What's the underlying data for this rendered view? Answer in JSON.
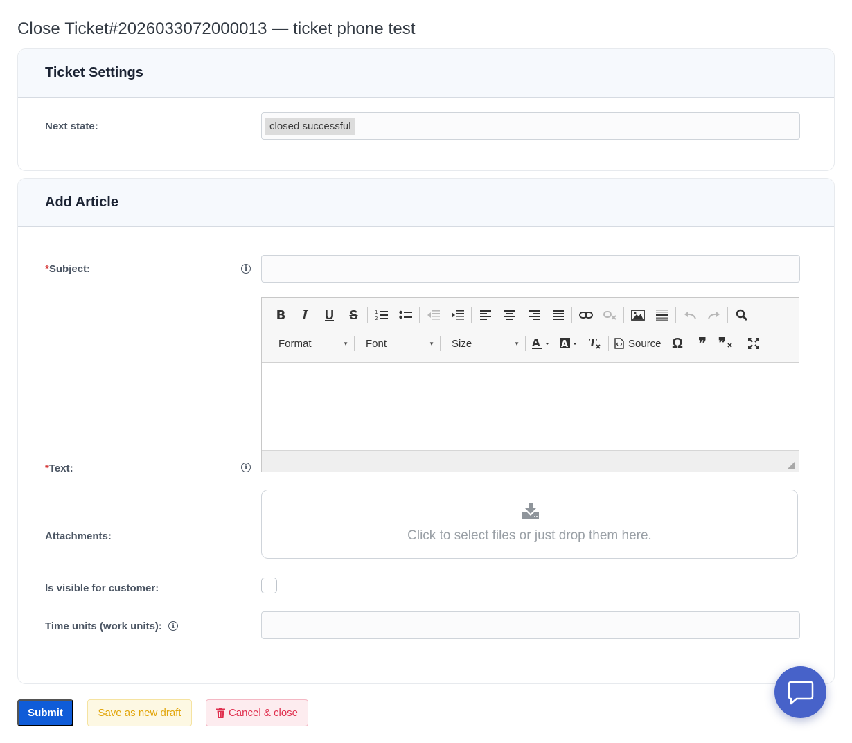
{
  "page": {
    "title": "Close Ticket#2026033072000013 — ticket phone test"
  },
  "ticket_settings": {
    "heading": "Ticket Settings",
    "next_state_label": "Next state:",
    "next_state_value": "closed successful"
  },
  "add_article": {
    "heading": "Add Article",
    "subject_required_mark": "*",
    "subject_label": "Subject:",
    "subject_value": "",
    "text_required_mark": "*",
    "text_label": "Text:",
    "text_value": "",
    "attachments_label": "Attachments:",
    "attachments_hint": "Click to select files or just drop them here.",
    "visible_label": "Is visible for customer:",
    "visible_checked": false,
    "time_units_label": "Time units (work units):",
    "time_units_value": ""
  },
  "editor": {
    "toolbar_row1": [
      "bold-icon",
      "italic-icon",
      "underline-icon",
      "strikethrough-icon",
      "numbered-list-icon",
      "bulleted-list-icon",
      "outdent-icon",
      "indent-icon",
      "align-left-icon",
      "align-center-icon",
      "align-right-icon",
      "justify-icon",
      "link-icon",
      "unlink-icon",
      "image-icon",
      "horizontal-line-icon",
      "undo-icon",
      "redo-icon",
      "find-icon"
    ],
    "format_label": "Format",
    "font_label": "Font",
    "size_label": "Size",
    "source_label": "Source"
  },
  "actions": {
    "submit": "Submit",
    "save_draft": "Save as new draft",
    "cancel": "Cancel & close"
  },
  "colors": {
    "primary": "#0f5cd8",
    "draft_text": "#e2a60c",
    "cancel_text": "#e0304f",
    "chat_fab": "#4762c9",
    "required": "#d63b3b"
  }
}
